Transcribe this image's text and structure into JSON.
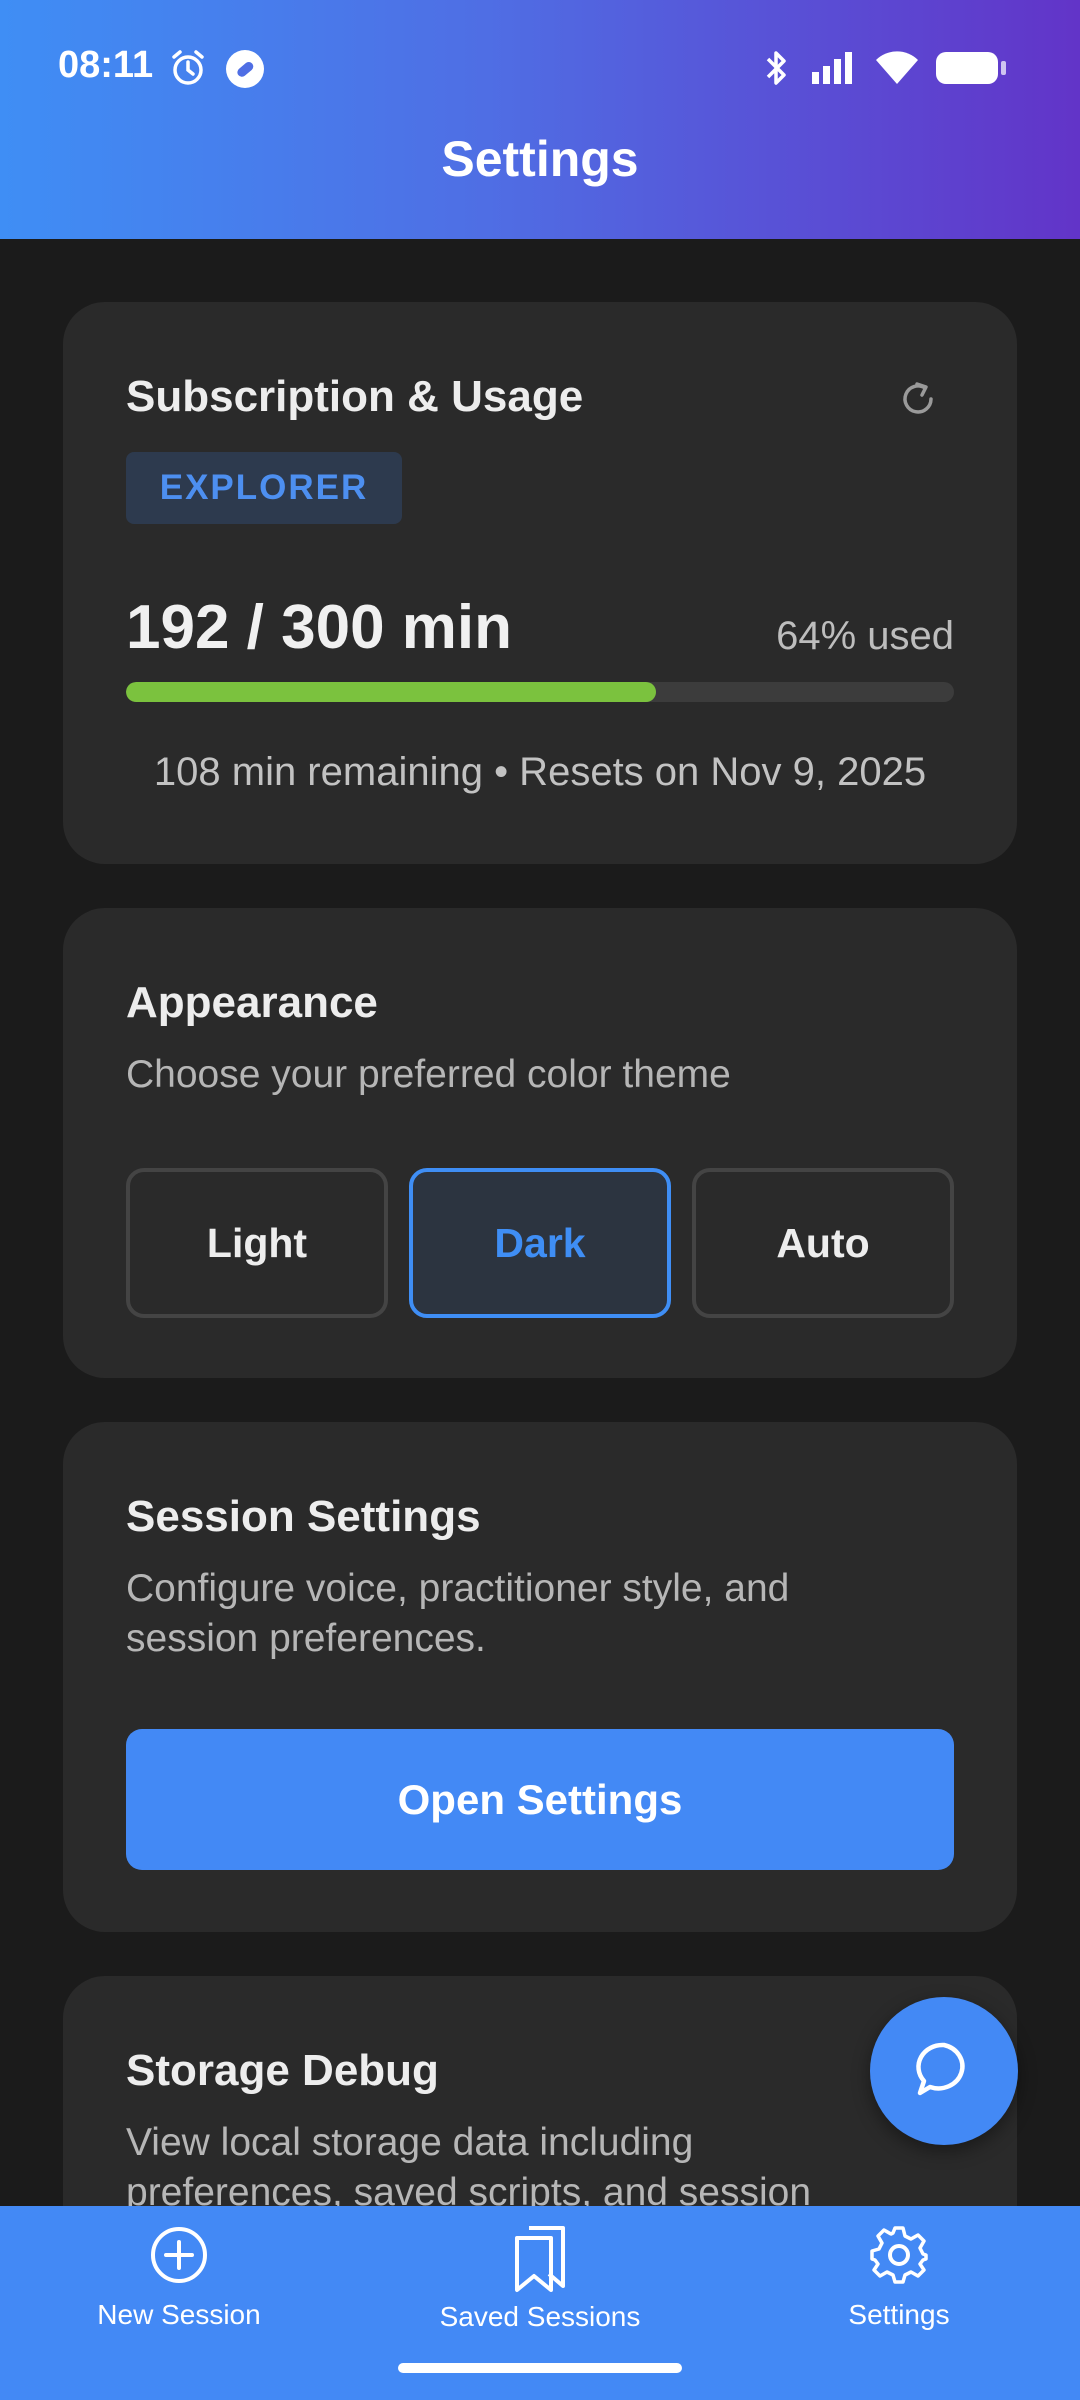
{
  "status_bar": {
    "time": "08:11"
  },
  "header": {
    "title": "Settings"
  },
  "subscription": {
    "title": "Subscription & Usage",
    "plan_badge": "EXPLORER",
    "usage_text": "192 / 300 min",
    "percent_text": "64% used",
    "progress_fraction": 0.64,
    "footer_text": "108 min remaining • Resets on Nov 9, 2025",
    "progress_color": "#7bc23e"
  },
  "appearance": {
    "title": "Appearance",
    "subtitle": "Choose your preferred color theme",
    "options": [
      "Light",
      "Dark",
      "Auto"
    ],
    "selected": "Dark"
  },
  "session_settings": {
    "title": "Session Settings",
    "subtitle_line1": "Configure voice, practitioner style, and",
    "subtitle_line2": "session preferences.",
    "button_label": "Open Settings"
  },
  "storage_debug": {
    "title": "Storage Debug",
    "subtitle_line1": "View local storage data including",
    "subtitle_line2": "preferences, saved scripts, and session"
  },
  "bottom_nav": {
    "items": [
      {
        "label": "New Session",
        "icon": "plus-circle-icon"
      },
      {
        "label": "Saved Sessions",
        "icon": "bookmarks-icon"
      },
      {
        "label": "Settings",
        "icon": "gear-icon"
      }
    ]
  },
  "colors": {
    "accent": "#4389f5",
    "background": "#1b1b1b",
    "card": "#2a2a2a"
  }
}
